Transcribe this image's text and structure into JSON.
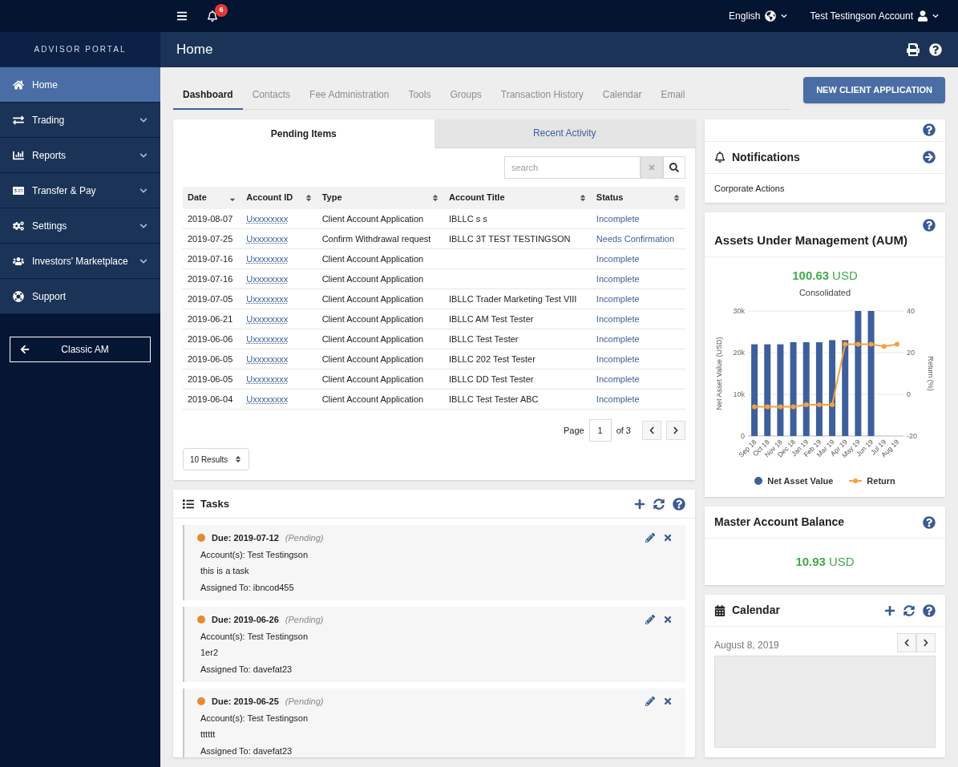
{
  "top_bar": {
    "notifications_badge": "6",
    "language": "English",
    "account": "Test Testingson Account"
  },
  "sidebar": {
    "title": "ADVISOR PORTAL",
    "items": [
      {
        "label": "Home",
        "selected": true,
        "submenu": false
      },
      {
        "label": "Trading",
        "selected": false,
        "submenu": true
      },
      {
        "label": "Reports",
        "selected": false,
        "submenu": true
      },
      {
        "label": "Transfer & Pay",
        "selected": false,
        "submenu": true
      },
      {
        "label": "Settings",
        "selected": false,
        "submenu": true
      },
      {
        "label": "Investors' Marketplace",
        "selected": false,
        "submenu": true
      },
      {
        "label": "Support",
        "selected": false,
        "submenu": false
      }
    ],
    "classic_button": "Classic AM"
  },
  "page_header": {
    "title": "Home"
  },
  "tabs": [
    {
      "label": "Dashboard",
      "selected": true
    },
    {
      "label": "Contacts",
      "selected": false
    },
    {
      "label": "Fee Administration",
      "selected": false
    },
    {
      "label": "Tools",
      "selected": false
    },
    {
      "label": "Groups",
      "selected": false
    },
    {
      "label": "Transaction History",
      "selected": false
    },
    {
      "label": "Calendar",
      "selected": false
    },
    {
      "label": "Email",
      "selected": false
    }
  ],
  "new_client_button": "NEW CLIENT APPLICATION",
  "pending_items": {
    "tabs": [
      {
        "label": "Pending Items",
        "selected": true
      },
      {
        "label": "Recent Activity",
        "selected": false
      }
    ],
    "search": {
      "placeholder": "search"
    },
    "columns": [
      {
        "label": "Date",
        "sorted": true
      },
      {
        "label": "Account ID",
        "sorted": false
      },
      {
        "label": "Type",
        "sorted": false
      },
      {
        "label": "Account Title",
        "sorted": false
      },
      {
        "label": "Status",
        "sorted": false
      }
    ],
    "rows": [
      {
        "date": "2019-08-07",
        "account_id": "Uxxxxxxxx",
        "type": "Client Account Application",
        "title": "IBLLC s s",
        "status": "Incomplete"
      },
      {
        "date": "2019-07-25",
        "account_id": "Uxxxxxxxx",
        "type": "Confirm Withdrawal request",
        "title": "IBLLC 3T TEST TESTINGSON",
        "status": "Needs Confirmation"
      },
      {
        "date": "2019-07-16",
        "account_id": "Uxxxxxxxx",
        "type": "Client Account Application",
        "status": "Incomplete"
      },
      {
        "date": "2019-07-16",
        "account_id": "Uxxxxxxxx",
        "type": "Client Account Application",
        "status": "Incomplete"
      },
      {
        "date": "2019-07-05",
        "account_id": "Uxxxxxxxx",
        "type": "Client Account Application",
        "title": "IBLLC Trader Marketing Test VIII",
        "status": "Incomplete"
      },
      {
        "date": "2019-06-21",
        "account_id": "Uxxxxxxxx",
        "type": "Client Account Application",
        "title": "IBLLC AM Test Tester",
        "status": "Incomplete"
      },
      {
        "date": "2019-06-06",
        "account_id": "Uxxxxxxxx",
        "type": "Client Account Application",
        "title": "IBLLC Test Tester",
        "status": "Incomplete"
      },
      {
        "date": "2019-06-05",
        "account_id": "Uxxxxxxxx",
        "type": "Client Account Application",
        "title": "IBLLC 202 Test Tester",
        "status": "Incomplete"
      },
      {
        "date": "2019-06-05",
        "account_id": "Uxxxxxxxx",
        "type": "Client Account Application",
        "title": "IBLLC DD Test Tester",
        "status": "Incomplete"
      },
      {
        "date": "2019-06-04",
        "account_id": "Uxxxxxxxx",
        "type": "Client Account Application",
        "title": "IBLLC Test Tester ABC",
        "status": "Incomplete"
      }
    ],
    "pagination": {
      "label": "Page",
      "page": "1",
      "total": "of 3"
    },
    "page_size": "10 Results"
  },
  "tasks": {
    "title": "Tasks",
    "items": [
      {
        "due": "Due: 2019-07-12",
        "status": "(Pending)",
        "account": "Account(s): Test Testingson",
        "note": "this is a task",
        "assigned": "Assigned To: ibncod455"
      },
      {
        "due": "Due: 2019-06-26",
        "status": "(Pending)",
        "account": "Account(s): Test Testingson",
        "note": "1er2",
        "assigned": "Assigned To: davefat23"
      },
      {
        "due": "Due: 2019-06-25",
        "status": "(Pending)",
        "account": "Account(s): Test Testingson",
        "note": "tttttt",
        "assigned": "Assigned To: davefat23"
      }
    ]
  },
  "notifications": {
    "title": "Notifications",
    "items": [
      "Corporate Actions"
    ]
  },
  "aum": {
    "title": "Assets Under Management (AUM)",
    "amount": "100.63",
    "currency": "USD",
    "caption": "Consolidated",
    "chart_data": {
      "type": "bar",
      "ylabel": "Net Asset Value (USD)",
      "y2label": "Return (%)",
      "categories": [
        "Sep 18",
        "Oct 18",
        "Nov 18",
        "Dec 18",
        "Jan 19",
        "Feb 19",
        "Mar 19",
        "Apr 19",
        "May 19",
        "Jun 19",
        "Jul 19",
        "Aug 19"
      ],
      "series": [
        {
          "name": "Net Asset Value",
          "color": "#3d5f9b",
          "type": "bar",
          "values": [
            22000,
            22000,
            22000,
            22500,
            22500,
            22500,
            23000,
            23000,
            30000,
            30000,
            null,
            null
          ]
        },
        {
          "name": "Return",
          "color": "#f5a140",
          "type": "line",
          "axis": "y2",
          "marker": true,
          "values": [
            -6,
            -6,
            -6,
            -6,
            -5,
            -5,
            -5,
            24,
            24,
            24,
            23,
            24
          ]
        }
      ],
      "ylim": [
        0,
        30000
      ],
      "yticks": [
        {
          "value": 0,
          "label": "0"
        },
        {
          "value": 10000,
          "label": "10k"
        },
        {
          "value": 20000,
          "label": "20k"
        },
        {
          "value": 30000,
          "label": "30k"
        }
      ],
      "y2lim": [
        -20,
        40
      ],
      "y2ticks": [
        -20,
        0,
        20,
        40
      ]
    }
  },
  "master_balance": {
    "title": "Master Account Balance",
    "amount": "10.93",
    "currency": "USD"
  },
  "calendar": {
    "title": "Calendar",
    "date": "August 8, 2019"
  }
}
